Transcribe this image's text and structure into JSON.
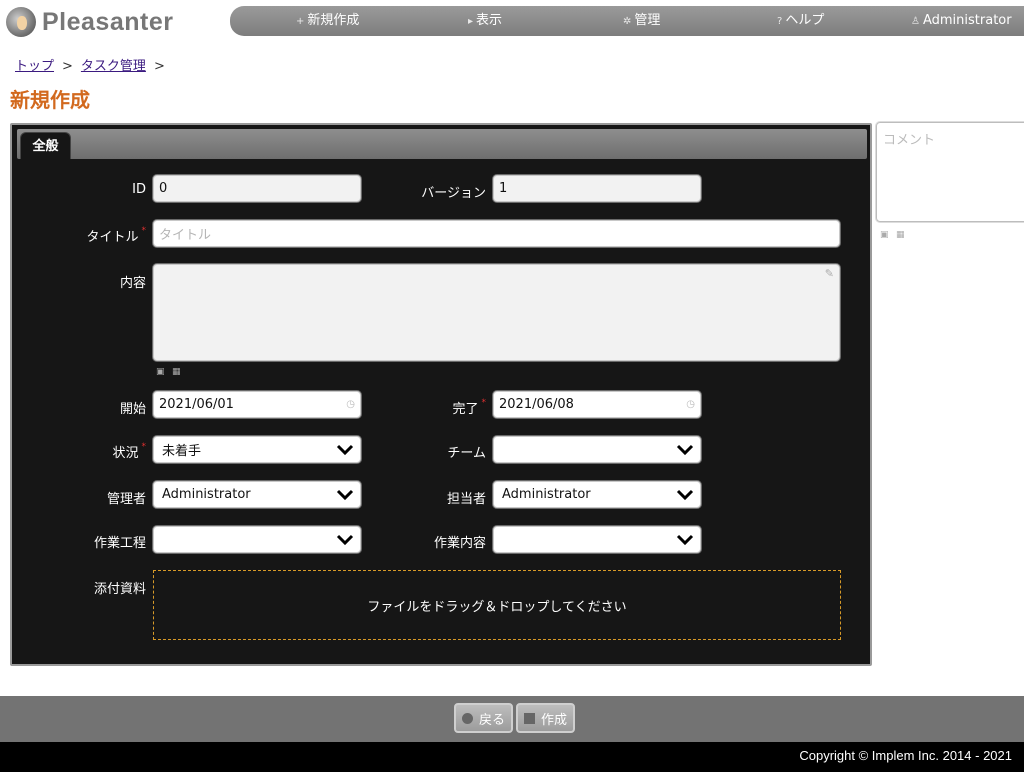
{
  "brand": {
    "name": "Pleasanter"
  },
  "nav": {
    "new": {
      "icon": "+",
      "label": "新規作成"
    },
    "view": {
      "icon": "▸",
      "label": "表示"
    },
    "manage": {
      "icon": "✲",
      "label": "管理"
    },
    "help": {
      "icon": "?",
      "label": "ヘルプ"
    },
    "user": {
      "icon": "♙",
      "label": "Administrator"
    }
  },
  "breadcrumb": {
    "items": [
      "トップ",
      "タスク管理"
    ],
    "separator": ">"
  },
  "page": {
    "title": "新規作成"
  },
  "tabs": {
    "general": "全般"
  },
  "form": {
    "id": {
      "label": "ID",
      "value": "0"
    },
    "version": {
      "label": "バージョン",
      "value": "1"
    },
    "title": {
      "label": "タイトル",
      "placeholder": "タイトル",
      "required_mark": "*"
    },
    "body": {
      "label": "内容"
    },
    "start": {
      "label": "開始",
      "value": "2021/06/01"
    },
    "complete": {
      "label": "完了",
      "value": "2021/06/08",
      "required_mark": "*"
    },
    "status": {
      "label": "状況",
      "value": "未着手",
      "required_mark": "*"
    },
    "team": {
      "label": "チーム",
      "value": ""
    },
    "manager": {
      "label": "管理者",
      "value": "Administrator"
    },
    "owner": {
      "label": "担当者",
      "value": "Administrator"
    },
    "work_process": {
      "label": "作業工程",
      "value": ""
    },
    "work_content": {
      "label": "作業内容",
      "value": ""
    },
    "attachments": {
      "label": "添付資料",
      "dropzone": "ファイルをドラッグ＆ドロップしてください"
    }
  },
  "comment": {
    "placeholder": "コメント"
  },
  "buttons": {
    "back": "戻る",
    "create": "作成"
  },
  "footer": {
    "copyright": "Copyright © Implem Inc. 2014 - 2021"
  },
  "colors": {
    "accent": "#d2691e",
    "panel": "#161616",
    "bar": "#737373",
    "required": "#e03030",
    "dropzone_border": "#d79a28"
  }
}
